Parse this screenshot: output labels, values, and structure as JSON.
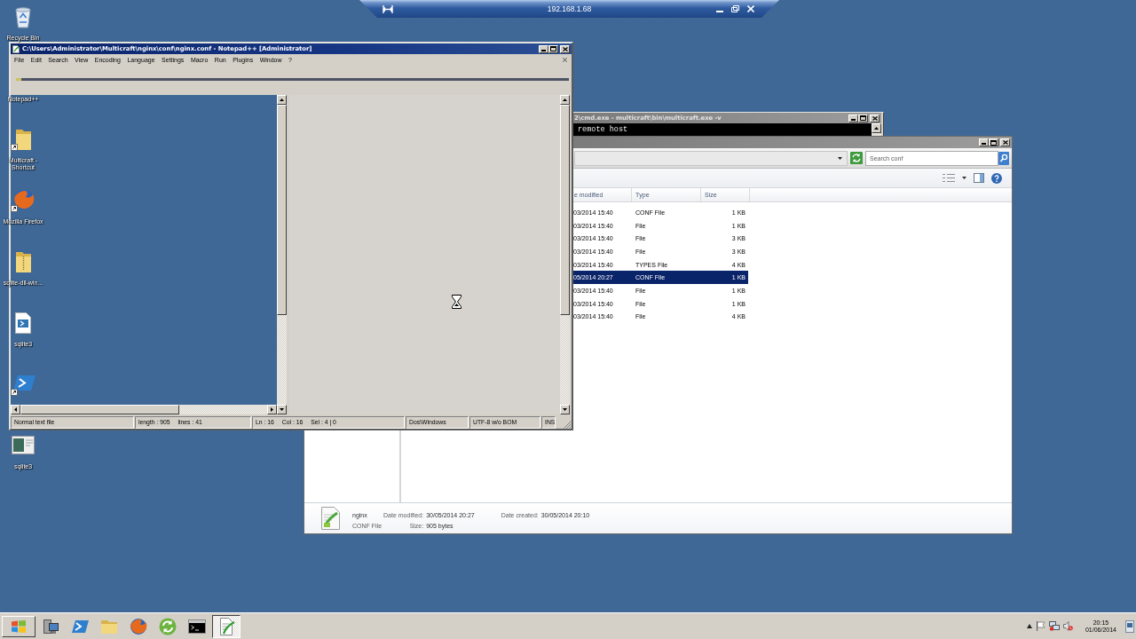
{
  "connection_bar": {
    "title": "192.168.1.68"
  },
  "desktop_icons": [
    {
      "label": "Recycle Bin",
      "kind": "recycle-bin",
      "shortcut": false
    },
    {
      "label": "Notepad++"
    },
    {
      "label": "Multicraft - Shortcut",
      "kind": "folder",
      "shortcut": true
    },
    {
      "label": "Mozilla Firefox",
      "kind": "browser",
      "shortcut": true
    },
    {
      "label": "sqlite-dll-win...",
      "kind": "zip-folder",
      "shortcut": false
    },
    {
      "label": "sqlite3",
      "kind": "script-file",
      "shortcut": false
    },
    {
      "kind": "terminal",
      "shortcut": true
    },
    {
      "label": "sqlite3",
      "kind": "app-window",
      "shortcut": false
    }
  ],
  "notepad": {
    "active": true,
    "title": "C:\\Users\\Administrator\\Multicraft\\nginx\\conf\\nginx.conf - Notepad++ [Administrator]",
    "menu": [
      "File",
      "Edit",
      "Search",
      "View",
      "Encoding",
      "Language",
      "Settings",
      "Macro",
      "Run",
      "Plugins",
      "Window",
      "?"
    ],
    "status_bar": [
      [
        "Normal text file"
      ],
      [
        "length : 905",
        "lines : 41"
      ],
      [
        "Ln : 16",
        "Col : 16",
        "Sel : 4 | 0"
      ],
      [
        "Dos\\Windows"
      ],
      [
        "UTF-8 w/o BOM"
      ],
      [
        "INS"
      ]
    ]
  },
  "cmd_window": {
    "active": false,
    "title": "2\\cmd.exe - multicraft\\bin\\multicraft.exe -v",
    "lines": [
      "remote host"
    ]
  },
  "explorer": {
    "active": false,
    "search": {
      "placeholder": "Search conf"
    },
    "columns": [
      "e modified",
      "Type",
      "Size"
    ],
    "rows": [
      {
        "cells": [
          "03/2014 15:40",
          "CONF File",
          "1 KB"
        ],
        "selected": false
      },
      {
        "cells": [
          "03/2014 15:40",
          "File",
          "1 KB"
        ],
        "selected": false
      },
      {
        "cells": [
          "03/2014 15:40",
          "File",
          "3 KB"
        ],
        "selected": false
      },
      {
        "cells": [
          "03/2014 15:40",
          "File",
          "3 KB"
        ],
        "selected": false
      },
      {
        "cells": [
          "03/2014 15:40",
          "TYPES File",
          "4 KB"
        ],
        "selected": false
      },
      {
        "cells": [
          "05/2014 20:27",
          "CONF File",
          "1 KB"
        ],
        "selected": true
      },
      {
        "cells": [
          "03/2014 15:40",
          "File",
          "1 KB"
        ],
        "selected": false
      },
      {
        "cells": [
          "03/2014 15:40",
          "File",
          "1 KB"
        ],
        "selected": false
      },
      {
        "cells": [
          "03/2014 15:40",
          "File",
          "4 KB"
        ],
        "selected": false
      }
    ],
    "details": {
      "name": "nginx",
      "type": "CONF File",
      "fields": [
        [
          {
            "label": "Date modified:",
            "value": "30/05/2014 20:27"
          },
          {
            "label": "Size:",
            "value": "905 bytes"
          }
        ],
        [
          {
            "label": "Date created:",
            "value": "30/05/2014 20:10"
          }
        ]
      ]
    }
  },
  "taskbar": {
    "items": [
      {
        "kind": "server",
        "active": false
      },
      {
        "kind": "terminal",
        "active": false
      },
      {
        "kind": "folder",
        "active": false
      },
      {
        "kind": "browser",
        "active": false
      },
      {
        "kind": "sync",
        "active": false
      },
      {
        "kind": "console",
        "active": false
      },
      {
        "kind": "notepad",
        "active": true
      }
    ],
    "clock": {
      "time": "20:15",
      "date": "01/06/2014"
    }
  }
}
